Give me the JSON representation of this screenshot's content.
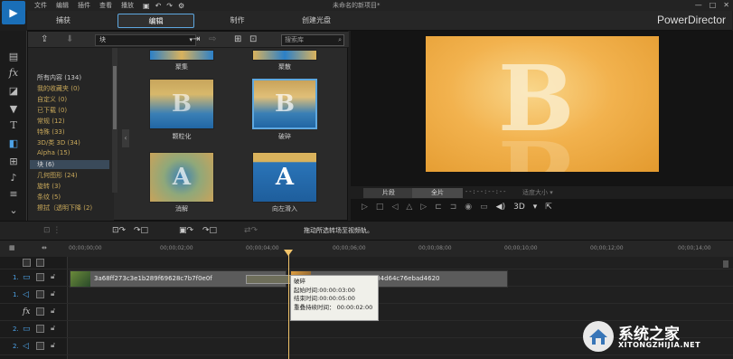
{
  "window": {
    "title": "未命名的新项目*",
    "brand": "PowerDirector",
    "menus": [
      "文件",
      "编辑",
      "插件",
      "查看",
      "播放"
    ]
  },
  "mode_tabs": [
    "捕获",
    "编辑",
    "制作",
    "创建光盘"
  ],
  "active_mode": "编辑",
  "library": {
    "category_select": "块",
    "search_placeholder": "搜索库",
    "categories": [
      {
        "label": "所有内容 (134)",
        "header": true
      },
      {
        "label": "我的收藏夹 (0)"
      },
      {
        "label": "自定义 (0)"
      },
      {
        "label": "已下载 (0)"
      },
      {
        "label": "常规 (12)"
      },
      {
        "label": "特殊 (33)"
      },
      {
        "label": "3D/类 3D (34)"
      },
      {
        "label": "Alpha (15)"
      },
      {
        "label": "块 (6)",
        "selected": true
      },
      {
        "label": "几何图形 (24)"
      },
      {
        "label": "旋转 (3)"
      },
      {
        "label": "条纹 (5)"
      },
      {
        "label": "擦拭（透明下降 (2)"
      }
    ],
    "transitions": [
      {
        "label": "聚集"
      },
      {
        "label": "聚散"
      },
      {
        "label": "颗粒化"
      },
      {
        "label": "破碎"
      },
      {
        "label": "消解"
      },
      {
        "label": "向左滑入"
      }
    ]
  },
  "preview": {
    "letter": "B",
    "clip_button": "片段",
    "movie_button": "全片",
    "timecode": "--:--:--:--",
    "size_label": "适度大小",
    "three_d_label": "3D"
  },
  "edit_toolbar": {
    "hint": "拖动所选转场至视频轨。"
  },
  "timeline": {
    "ticks": [
      "00;00;00;00",
      "00;00;02;00",
      "00;00;04;00",
      "00;00;06;00",
      "00;00;08;00",
      "00;00;10;00",
      "00;00;12;00",
      "00;00;14;00"
    ],
    "tracks": [
      {
        "num": "1.",
        "icon": "▭"
      },
      {
        "num": "1.",
        "icon": "◁"
      },
      {
        "num": "",
        "icon": "fx"
      },
      {
        "num": "2.",
        "icon": "▭"
      },
      {
        "num": "2.",
        "icon": "◁"
      }
    ],
    "clips": [
      {
        "label": "3a68ff273c3e1b289f69628c7b7f0e0f"
      },
      {
        "label": "370ace8df53227a204d64c76ebad4620"
      }
    ]
  },
  "tooltip": {
    "title": "破碎",
    "start": "起始时间:00:00:03:00",
    "end": "结束时间:00:00:05:00",
    "overlap": "重叠持续时间： 00:00:02:00"
  },
  "watermark": {
    "name": "系统之家",
    "url": "XITONGZHIJIA.NET"
  },
  "colors": {
    "accent": "#4da3e8",
    "category_text": "#c8a85a",
    "playhead": "#f0c36a",
    "preview_orange": "#f2b24e"
  }
}
